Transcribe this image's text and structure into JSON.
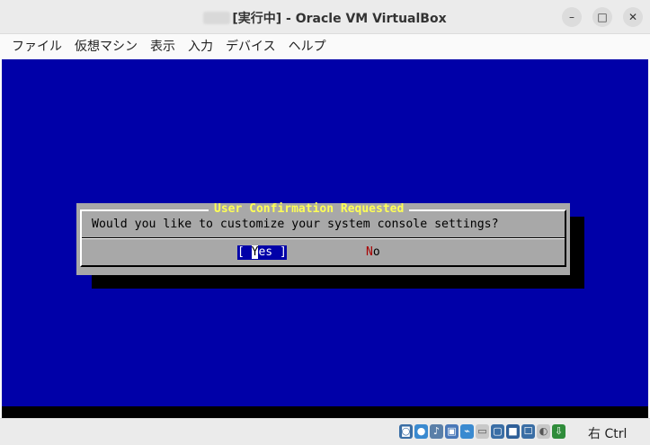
{
  "window": {
    "title_prefix": "[実行中] - Oracle VM VirtualBox",
    "minimize_glyph": "–",
    "maximize_glyph": "□",
    "close_glyph": "✕"
  },
  "menu": [
    "ファイル",
    "仮想マシン",
    "表示",
    "入力",
    "デバイス",
    "ヘルプ"
  ],
  "dialog": {
    "title": "User Confirmation Requested",
    "message": "Would you like to customize your system console settings?",
    "yes_left": "[ ",
    "yes_hot": "Y",
    "yes_rest": "es ]",
    "no_hot": "N",
    "no_rest": "o"
  },
  "status": {
    "icons": [
      "hdd-icon",
      "optical-icon",
      "audio-icon",
      "network-icon",
      "usb-icon",
      "shared-folder-icon",
      "display-icon",
      "recording-icon",
      "cpu-icon",
      "mouse-integration-icon",
      "keyboard-icon"
    ],
    "host_key": "右 Ctrl"
  },
  "colors": {
    "vm_background": "#0000a8",
    "dialog_gray": "#a8a8a8",
    "title_yellow": "#ffff55",
    "hotkey_red": "#a80000"
  }
}
